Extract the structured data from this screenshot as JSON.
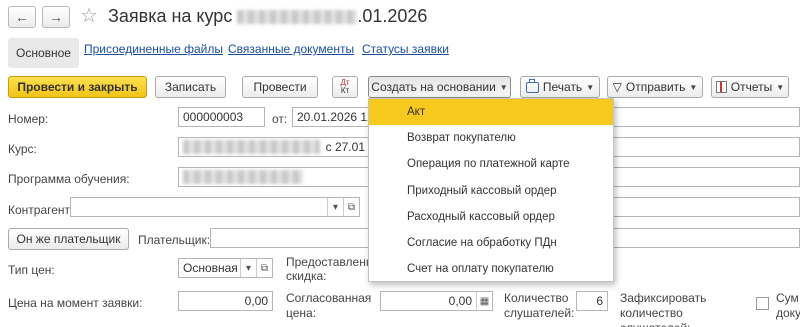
{
  "header": {
    "back_glyph": "←",
    "forward_glyph": "→",
    "star_glyph": "☆",
    "title_prefix": "Заявка на курс",
    "title_suffix": ".01.2026"
  },
  "tabs": [
    {
      "label": "Основное"
    },
    {
      "label": "Присоединенные файлы"
    },
    {
      "label": "Связанные документы"
    },
    {
      "label": "Статусы заявки"
    }
  ],
  "toolbar": {
    "post_close": "Провести и закрыть",
    "save": "Записать",
    "post": "Провести",
    "dt_kt_top": "Дт",
    "dt_kt_bottom": "Кт",
    "create_based": "Создать на основании",
    "print": "Печать",
    "send": "Отправить",
    "reports": "Отчеты"
  },
  "form": {
    "number_label": "Номер:",
    "number_value": "000000003",
    "from_label": "от:",
    "date_value": "20.01.2026 12",
    "course_label": "Курс:",
    "course_value_suffix": "с 27.01",
    "program_label": "Программа обучения:",
    "counterparty_label": "Контрагент:",
    "same_payer_button": "Он же плательщик",
    "payer_label": "Плательщик:",
    "price_type_label": "Тип цен:",
    "price_type_value": "Основная",
    "provided_discount_label": "Предоставленная скидка:",
    "price_at_request_label": "Цена на момент заявки:",
    "price_at_request_value": "0,00",
    "agreed_price_label": "Согласованная цена:",
    "agreed_price_value": "0,00",
    "listeners_count_label": "Количество слушателей:",
    "listeners_count_value": "6",
    "fix_listeners_label": "Зафиксировать количество слушателей:",
    "sum_label_cut": "Сум докум"
  },
  "dropdown": {
    "items": [
      "Акт",
      "Возврат покупателю",
      "Операция по платежной карте",
      "Приходный кассовый ордер",
      "Расходный кассовый ордер",
      "Согласие на обработку ПДн",
      "Счет на оплату покупателю"
    ],
    "highlight_color": "#f7c91f"
  },
  "colors": {
    "primary_button": "#f2c316",
    "link": "#1a4fa0"
  }
}
